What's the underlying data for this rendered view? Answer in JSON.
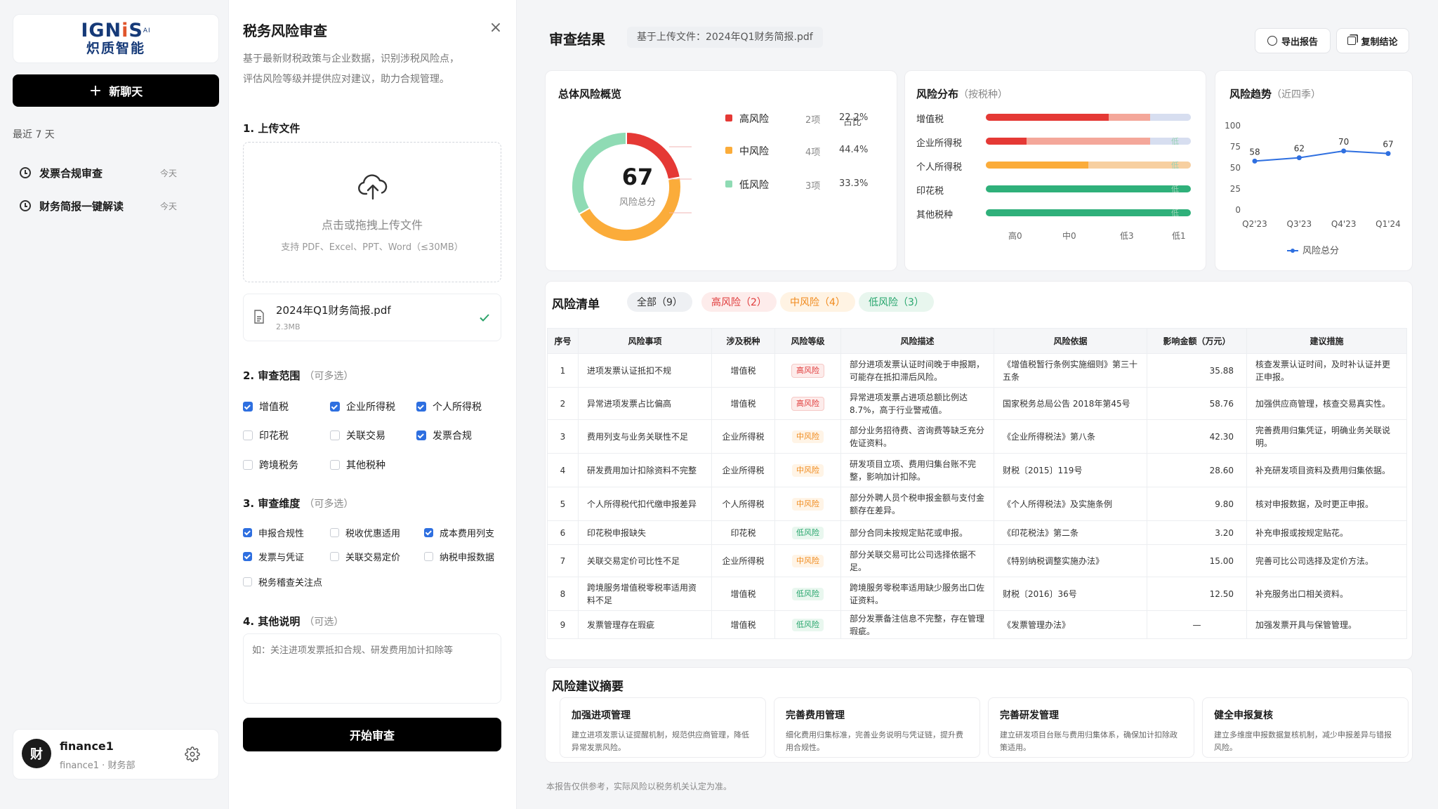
{
  "sidebar": {
    "logo_en_main": "IGN",
    "logo_en_accent": "i",
    "logo_en_tail": "S",
    "logo_en_sup": "AI",
    "logo_zh": "炽质智能",
    "new_chat": "新聊天",
    "recent_label": "最近 7 天",
    "history": [
      {
        "title": "发票合规审查",
        "time": "今天"
      },
      {
        "title": "财务简报一键解读",
        "time": "今天"
      }
    ],
    "user": {
      "avatar": "财",
      "name": "finance1",
      "sub": "finance1 · 财务部"
    }
  },
  "form": {
    "title": "税务风险审查",
    "desc_line1": "基于最新财税政策与企业数据，识别涉税风险点，",
    "desc_line2": "评估风险等级并提供应对建议，助力合规管理。",
    "s1_title": "1. 上传文件",
    "upload_main": "点击或拖拽上传文件",
    "upload_sub": "支持 PDF、Excel、PPT、Word（≤30MB）",
    "file_name": "2024年Q1财务简报.pdf",
    "file_size": "2.3MB",
    "s2_title": "2. 审查范围",
    "s2_opt": "（可多选）",
    "scope": [
      {
        "label": "增值税",
        "checked": true
      },
      {
        "label": "企业所得税",
        "checked": true
      },
      {
        "label": "个人所得税",
        "checked": true
      },
      {
        "label": "印花税",
        "checked": false
      },
      {
        "label": "关联交易",
        "checked": false
      },
      {
        "label": "发票合规",
        "checked": true
      },
      {
        "label": "跨境税务",
        "checked": false
      },
      {
        "label": "其他税种",
        "checked": false
      }
    ],
    "s3_title": "3. 审查维度",
    "s3_opt": "（可多选）",
    "dims": [
      {
        "label": "申报合规性",
        "checked": true
      },
      {
        "label": "税收优惠适用",
        "checked": false
      },
      {
        "label": "成本费用列支",
        "checked": true
      },
      {
        "label": "发票与凭证",
        "checked": true
      },
      {
        "label": "关联交易定价",
        "checked": false
      },
      {
        "label": "纳税申报数据",
        "checked": false
      },
      {
        "label": "税务稽查关注点",
        "checked": false
      }
    ],
    "s4_title": "4. 其他说明",
    "s4_opt": "（可选）",
    "notes_placeholder": "如：关注进项发票抵扣合规、研发费用加计扣除等",
    "start": "开始审查"
  },
  "results": {
    "title": "审查结果",
    "file_tag": "基于上传文件：2024年Q1财务简报.pdf",
    "export": "导出报告",
    "copy": "复制结论",
    "overview": {
      "title": "总体风险概览",
      "score": "67",
      "score_label": "风险总分",
      "share_header": "占比",
      "levels": [
        {
          "name": "高风险",
          "count": "2项",
          "pct": "22.2%",
          "color": "#e53935",
          "value": 22.2
        },
        {
          "name": "中风险",
          "count": "4项",
          "pct": "44.4%",
          "color": "#fbac3a",
          "value": 44.4
        },
        {
          "name": "低风险",
          "count": "3项",
          "pct": "33.3%",
          "color": "#8fdbb4",
          "value": 33.3
        }
      ]
    },
    "distribution": {
      "title": "风险分布",
      "title_sub": "（按税种）",
      "rows": [
        {
          "name": "增值税",
          "high": 0.6,
          "mid": 0.2,
          "low": 0.2,
          "tag": ""
        },
        {
          "name": "企业所得税",
          "high": 0.2,
          "mid": 0.6,
          "low": 0.2,
          "tag": "低"
        },
        {
          "name": "个人所得税",
          "high": 0.0,
          "mid": 0.5,
          "low": 0.5,
          "tag": "低"
        },
        {
          "name": "印花税",
          "high": 0.0,
          "mid": 0.0,
          "low": 1.0,
          "tag": "低"
        },
        {
          "name": "其他税种",
          "high": 0.0,
          "mid": 0.0,
          "low": 1.0,
          "tag": "低"
        }
      ],
      "axis": [
        "高0",
        "中0",
        "低3",
        "低1"
      ]
    },
    "trend": {
      "title": "风险趋势",
      "title_sub": "（近四季）",
      "legend": "风险总分"
    },
    "list": {
      "title": "风险清单",
      "filters": [
        {
          "label": "全部（9）"
        },
        {
          "label": "高风险（2）"
        },
        {
          "label": "中风险（4）"
        },
        {
          "label": "低风险（3）"
        }
      ],
      "headers": [
        "序号",
        "风险事项",
        "涉及税种",
        "风险等级",
        "风险描述",
        "风险依据",
        "影响金额（万元）",
        "建议措施"
      ],
      "rows": [
        {
          "no": "1",
          "item": "进项发票认证抵扣不规",
          "tax": "增值税",
          "level": "高风险",
          "lv": "high",
          "desc": "部分进项发票认证时间晚于申报期，可能存在抵扣滞后风险。",
          "basis": "《增值税暂行条例实施细则》第三十五条",
          "amt": "35.88",
          "action": "核查发票认证时间，及时补认证并更正申报。"
        },
        {
          "no": "2",
          "item": "异常进项发票占比偏高",
          "tax": "增值税",
          "level": "高风险",
          "lv": "high",
          "desc": "异常进项发票占进项总额比例达 8.7%，高于行业警戒值。",
          "basis": "国家税务总局公告 2018年第45号",
          "amt": "58.76",
          "action": "加强供应商管理，核查交易真实性。"
        },
        {
          "no": "3",
          "item": "费用列支与业务关联性不足",
          "tax": "企业所得税",
          "level": "中风险",
          "lv": "mid",
          "desc": "部分业务招待费、咨询费等缺乏充分佐证资料。",
          "basis": "《企业所得税法》第八条",
          "amt": "42.30",
          "action": "完善费用归集凭证，明确业务关联说明。"
        },
        {
          "no": "4",
          "item": "研发费用加计扣除资料不完整",
          "tax": "企业所得税",
          "level": "中风险",
          "lv": "mid",
          "desc": "研发项目立项、费用归集台账不完整，影响加计扣除。",
          "basis": "财税〔2015〕119号",
          "amt": "28.60",
          "action": "补充研发项目资料及费用归集依据。"
        },
        {
          "no": "5",
          "item": "个人所得税代扣代缴申报差异",
          "tax": "个人所得税",
          "level": "中风险",
          "lv": "mid",
          "desc": "部分外聘人员个税申报金额与支付金额存在差异。",
          "basis": "《个人所得税法》及实施条例",
          "amt": "9.80",
          "action": "核对申报数据，及时更正申报。"
        },
        {
          "no": "6",
          "item": "印花税申报缺失",
          "tax": "印花税",
          "level": "低风险",
          "lv": "low",
          "desc": "部分合同未按规定贴花或申报。",
          "basis": "《印花税法》第二条",
          "amt": "3.20",
          "action": "补充申报或按规定贴花。"
        },
        {
          "no": "7",
          "item": "关联交易定价可比性不足",
          "tax": "企业所得税",
          "level": "中风险",
          "lv": "mid",
          "desc": "部分关联交易可比公司选择依据不足。",
          "basis": "《特别纳税调整实施办法》",
          "amt": "15.00",
          "action": "完善可比公司选择及定价方法。"
        },
        {
          "no": "8",
          "item": "跨境服务增值税零税率适用资料不足",
          "tax": "增值税",
          "level": "低风险",
          "lv": "low",
          "desc": "跨境服务零税率适用缺少服务出口佐证资料。",
          "basis": "财税〔2016〕36号",
          "amt": "12.50",
          "action": "补充服务出口相关资料。"
        },
        {
          "no": "9",
          "item": "发票管理存在瑕疵",
          "tax": "增值税",
          "level": "低风险",
          "lv": "low",
          "desc": "部分发票备注信息不完整，存在管理瑕疵。",
          "basis": "《发票管理办法》",
          "amt": "—",
          "action": "加强发票开具与保管管理。"
        }
      ]
    },
    "summary": {
      "title": "风险建议摘要",
      "cards": [
        {
          "title": "加强进项管理",
          "desc": "建立进项发票认证提醒机制，规范供应商管理，降低异常发票风险。"
        },
        {
          "title": "完善费用管理",
          "desc": "细化费用归集标准，完善业务说明与凭证链，提升费用合规性。"
        },
        {
          "title": "完善研发管理",
          "desc": "建立研发项目台账与费用归集体系，确保加计扣除政策适用。"
        },
        {
          "title": "健全申报复核",
          "desc": "建立多维度申报数据复核机制，减少申报差异与错报风险。"
        }
      ]
    },
    "footer": "本报告仅供参考，实际风险以税务机关认定为准。"
  },
  "chart_data": {
    "type": "line",
    "x": [
      "Q2'23",
      "Q3'23",
      "Q4'23",
      "Q1'24"
    ],
    "series": [
      {
        "name": "风险总分",
        "values": [
          58,
          62,
          70,
          67
        ]
      }
    ],
    "ylim": [
      0,
      100
    ],
    "yticks": [
      "0",
      "25",
      "50",
      "75",
      "100"
    ],
    "grid": false,
    "legend": "bottom",
    "color": "#2e6fe0"
  }
}
